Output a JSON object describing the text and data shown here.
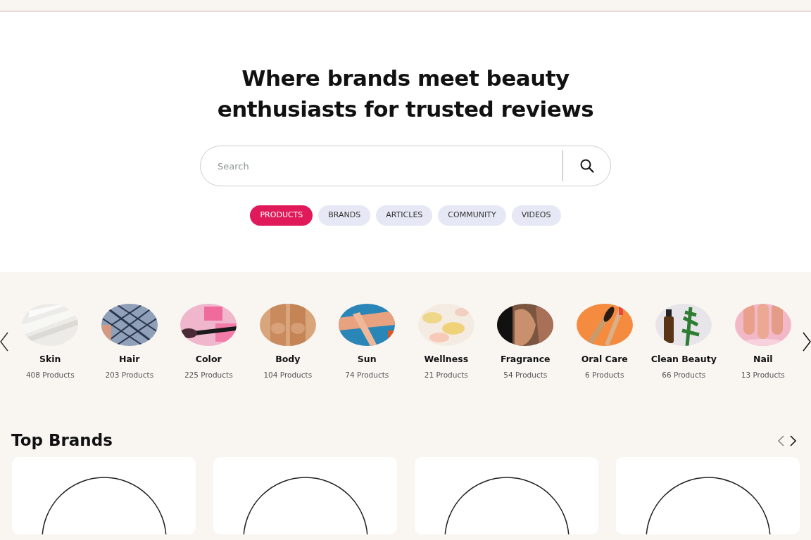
{
  "hero": {
    "title": "Where brands meet beauty enthusiasts for trusted reviews"
  },
  "search": {
    "placeholder": "Search"
  },
  "filters": [
    {
      "label": "PRODUCTS",
      "selected": true
    },
    {
      "label": "BRANDS",
      "selected": false
    },
    {
      "label": "ARTICLES",
      "selected": false
    },
    {
      "label": "COMMUNITY",
      "selected": false
    },
    {
      "label": "VIDEOS",
      "selected": false
    }
  ],
  "categories": [
    {
      "name": "Skin",
      "count": "408 Products"
    },
    {
      "name": "Hair",
      "count": "203 Products"
    },
    {
      "name": "Color",
      "count": "225 Products"
    },
    {
      "name": "Body",
      "count": "104 Products"
    },
    {
      "name": "Sun",
      "count": "74 Products"
    },
    {
      "name": "Wellness",
      "count": "21 Products"
    },
    {
      "name": "Fragrance",
      "count": "54 Products"
    },
    {
      "name": "Oral Care",
      "count": "6 Products"
    },
    {
      "name": "Clean Beauty",
      "count": "66 Products"
    },
    {
      "name": "Nail",
      "count": "13 Products"
    }
  ],
  "top_brands": {
    "title": "Top Brands"
  }
}
